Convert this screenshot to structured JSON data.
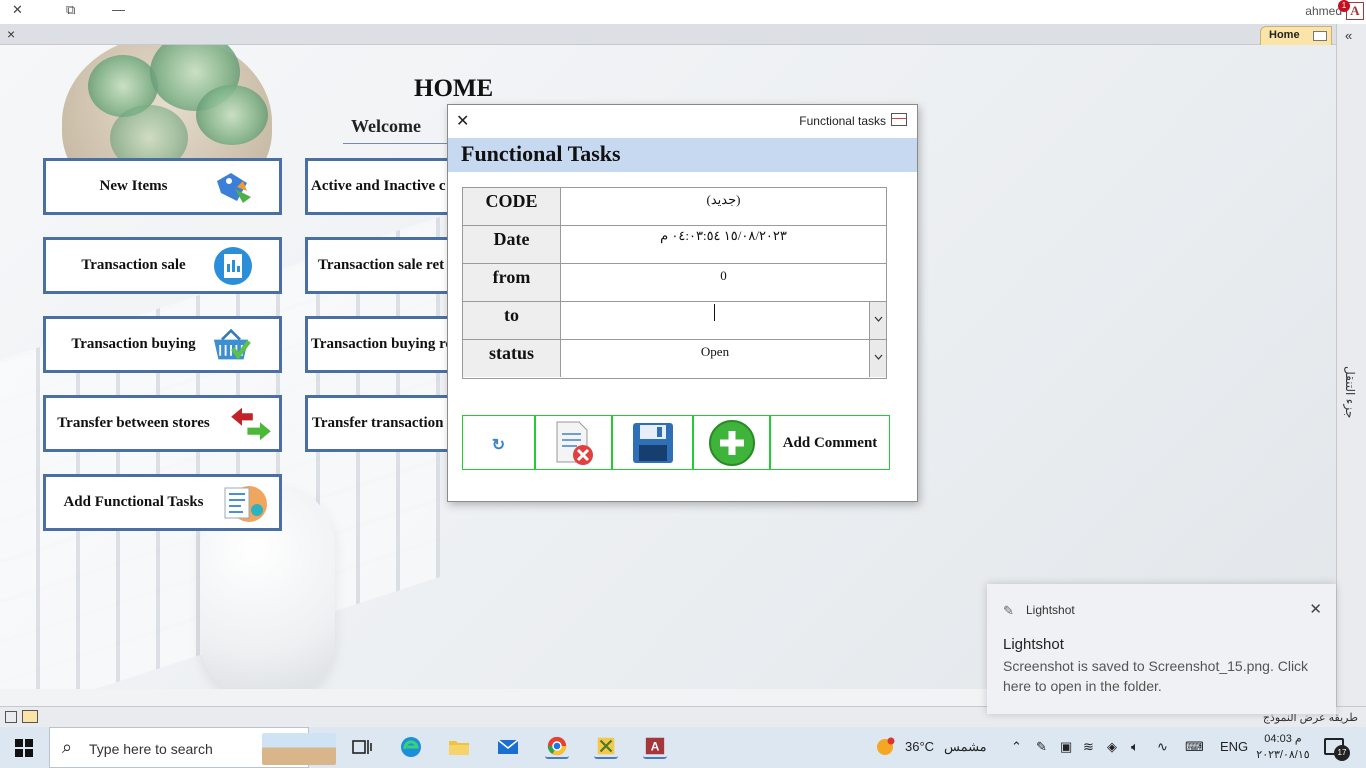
{
  "titlebar": {
    "minimize": "—",
    "restore": "⧉",
    "user": "ahmed",
    "app_letter": "A",
    "badge_count": "1"
  },
  "tabs": {
    "close_glyph": "×",
    "home_tab": "Home"
  },
  "navpane": {
    "collapse_glyph": "«",
    "label": "جزء التنقل"
  },
  "home": {
    "title": "HOME",
    "welcome": "Welcome",
    "left_buttons": [
      {
        "label": "New Items",
        "icon": "price-tag-icon"
      },
      {
        "label": "Transaction sale",
        "icon": "receipt-icon"
      },
      {
        "label": "Transaction buying",
        "icon": "shopping-basket-icon"
      },
      {
        "label": "Transfer between stores",
        "icon": "transfer-arrows-icon"
      },
      {
        "label": "Add Functional Tasks",
        "icon": "task-list-icon"
      }
    ],
    "right_buttons": [
      {
        "label": "Active and Inactive c"
      },
      {
        "label": "Transaction sale ret"
      },
      {
        "label": "Transaction buying re"
      },
      {
        "label": "Transfer transaction"
      }
    ]
  },
  "dialog": {
    "window_title": "Functional tasks",
    "close_glyph": "✕",
    "header": "Functional Tasks",
    "fields": [
      {
        "label": "CODE",
        "value": "(جديد)"
      },
      {
        "label": "Date",
        "value": "١٥/٠٨/٢٠٢٣ ٠٤:٠٣:٥٤ م"
      },
      {
        "label": "from",
        "value": "0"
      },
      {
        "label": "to",
        "value": ""
      },
      {
        "label": "status",
        "value": "Open"
      }
    ],
    "buttons": {
      "refresh_glyph": "↻",
      "add_comment": "Add Comment"
    }
  },
  "statusbar": {
    "view_text": "طريقه عرض النموذج"
  },
  "toast": {
    "app": "Lightshot",
    "close_glyph": "✕",
    "title": "Lightshot",
    "message": "Screenshot is saved to Screenshot_15.png. Click here to open in the folder."
  },
  "taskbar": {
    "search_placeholder": "Type here to search",
    "weather_temp": "36°C",
    "weather_text": "مشمس",
    "language": "ENG",
    "time": "04:03 م",
    "date": "٢٠٢٣/٠٨/١٥",
    "notification_count": "17"
  },
  "colors": {
    "button_border": "#4a6fa5",
    "dialog_header": "#c7d9f1",
    "action_border": "#22cc33",
    "home_tab": "#fbe4a7"
  }
}
